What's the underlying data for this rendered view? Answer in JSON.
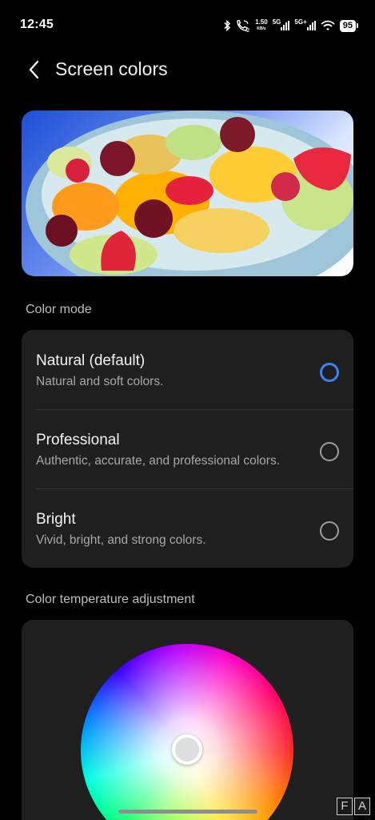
{
  "status_bar": {
    "time": "12:45",
    "net_speed_value": "1.50",
    "net_speed_unit": "KB/s",
    "net1_label": "5G",
    "net2_label": "5G+",
    "battery": "95",
    "icons": [
      "bluetooth-icon",
      "call-icon",
      "signal-icon",
      "wifi-icon",
      "battery-icon"
    ]
  },
  "header": {
    "title": "Screen colors",
    "back_icon": "chevron-left-icon"
  },
  "color_mode": {
    "section_title": "Color mode",
    "options": [
      {
        "label": "Natural (default)",
        "description": "Natural and soft colors.",
        "selected": true
      },
      {
        "label": "Professional",
        "description": "Authentic, accurate, and professional colors.",
        "selected": false
      },
      {
        "label": "Bright",
        "description": "Vivid, bright, and strong colors.",
        "selected": false
      }
    ]
  },
  "temperature": {
    "section_title": "Color temperature adjustment"
  },
  "watermark": {
    "left": "F",
    "right": "A"
  },
  "colors": {
    "accent": "#3b82f6",
    "card_bg": "#1f1f1f",
    "background": "#000000"
  }
}
